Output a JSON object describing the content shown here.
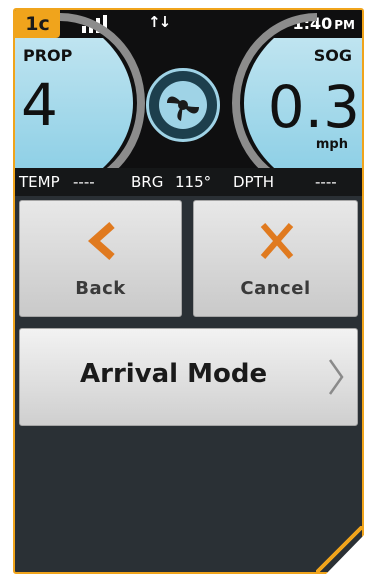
{
  "frame_tag": "1c",
  "statusbar": {
    "time": "1:40",
    "ampm": "PM",
    "data_arrows": "↑↓"
  },
  "gauges": {
    "prop": {
      "label": "PROP",
      "value": "4"
    },
    "sog": {
      "label": "SOG",
      "value": "0.3",
      "unit": "mph"
    }
  },
  "infobar": {
    "temp_label": "TEMP",
    "temp_value": "----",
    "brg_label": "BRG",
    "brg_value": "115°",
    "depth_label": "DPTH",
    "depth_value": "----"
  },
  "buttons": {
    "back": "Back",
    "cancel": "Cancel",
    "arrival": "Arrival Mode"
  },
  "colors": {
    "accent": "#f0a41c",
    "icon_orange": "#e07a1f",
    "gauge_blue": "#8fd0e6"
  }
}
